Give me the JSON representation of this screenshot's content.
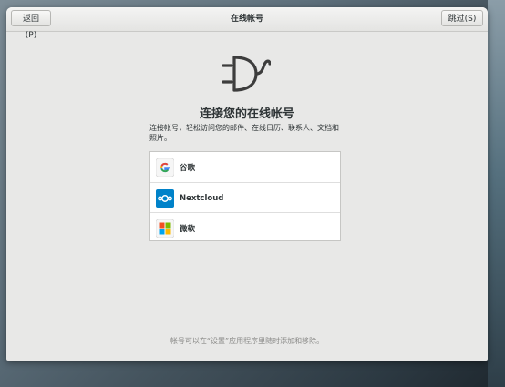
{
  "header": {
    "back_label": "返回(P)",
    "title": "在线帐号",
    "skip_label": "跳过(S)"
  },
  "main": {
    "heading": "连接您的在线帐号",
    "description": "连接帐号，轻松访问您的邮件、在线日历、联系人、文档和照片。",
    "providers": [
      {
        "label": "谷歌",
        "icon": "google-icon"
      },
      {
        "label": "Nextcloud",
        "icon": "nextcloud-icon"
      },
      {
        "label": "微软",
        "icon": "microsoft-icon"
      }
    ],
    "footer_note": "帐号可以在“设置”应用程序里随时添加和移除。"
  },
  "colors": {
    "window_bg": "#e8e8e7",
    "nextcloud_blue": "#0082c9",
    "google_blue": "#4285f4",
    "google_red": "#ea4335",
    "google_yellow": "#fbbc05",
    "google_green": "#34a853",
    "ms_red": "#f25022",
    "ms_green": "#7fba00",
    "ms_blue": "#00a4ef",
    "ms_yellow": "#ffb900"
  }
}
